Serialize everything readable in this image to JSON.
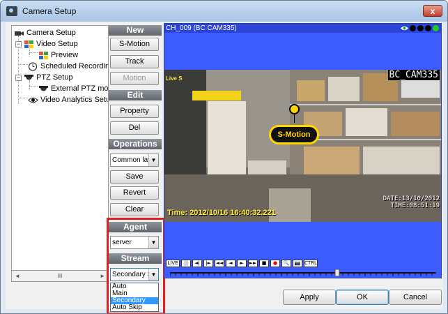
{
  "window": {
    "title": "Camera Setup",
    "close_label": "x"
  },
  "tree": {
    "items": [
      {
        "label": "Camera Setup",
        "icon": "camera-icon"
      },
      {
        "label": "Video Setup",
        "icon": "video-grid-icon"
      },
      {
        "label": "Preview",
        "icon": "video-grid-icon"
      },
      {
        "label": "Scheduled Recording",
        "icon": "clock-icon"
      },
      {
        "label": "PTZ Setup",
        "icon": "ptz-dome-icon"
      },
      {
        "label": "External PTZ mod",
        "icon": "ptz-dome-icon"
      },
      {
        "label": "Video Analytics Setup",
        "icon": "eye-icon"
      }
    ],
    "scroll_label": "III"
  },
  "sections": {
    "new": "New",
    "edit": "Edit",
    "operations": "Operations",
    "agent": "Agent",
    "stream": "Stream"
  },
  "buttons": {
    "smotion": "S-Motion",
    "track": "Track",
    "motion": "Motion",
    "property": "Property",
    "del": "Del",
    "save": "Save",
    "revert": "Revert",
    "clear": "Clear"
  },
  "combos": {
    "operations": "Common lay",
    "agent": "server",
    "stream": "Secondary S"
  },
  "stream_options": [
    "Auto",
    "Main",
    "Secondary",
    "Auto Skip"
  ],
  "stream_selected_index": 2,
  "video": {
    "channel_title": "CH_009 (BC CAM335)",
    "camera_name": "BC_CAM335",
    "live_label": "Live S",
    "time_overlay": "Time: 2012/10/16 16:40:32.221",
    "date_overlay": "DATE:13/10/2012",
    "time_small": "TIME:08:51:19",
    "smotion_overlay": "S-Motion",
    "status_colors": [
      "#000000",
      "#000000",
      "#000000",
      "#22cc22"
    ]
  },
  "controls": [
    "LIVE",
    "||",
    "◄|",
    "|►",
    "◄◄",
    "◄",
    "►",
    "►►",
    "■",
    "●",
    "🔍",
    "📷",
    "CTRL"
  ],
  "dialog_buttons": {
    "apply": "Apply",
    "ok": "OK",
    "cancel": "Cancel"
  }
}
